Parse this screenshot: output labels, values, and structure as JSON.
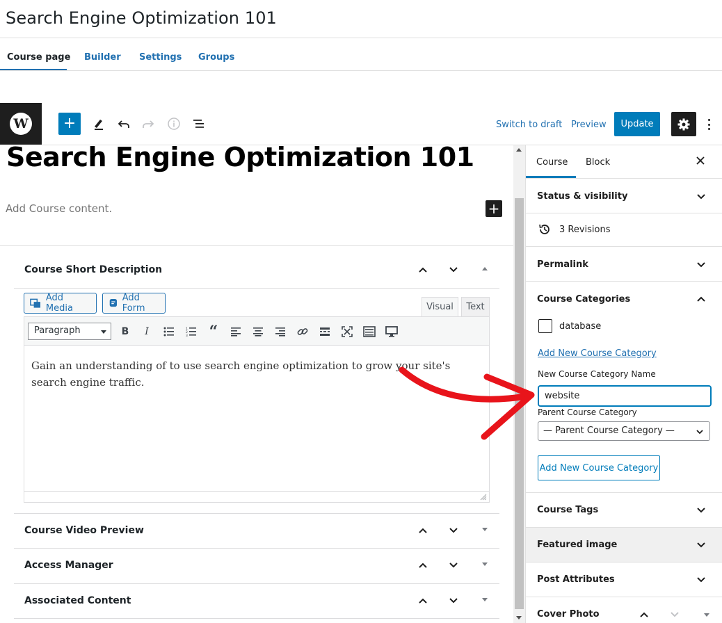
{
  "page": {
    "title": "Search Engine Optimization 101"
  },
  "tabs": [
    {
      "label": "Course page",
      "active": true
    },
    {
      "label": "Builder",
      "active": false
    },
    {
      "label": "Settings",
      "active": false
    },
    {
      "label": "Groups",
      "active": false
    }
  ],
  "toolbar": {
    "add_icon": "plus-icon",
    "switch_to_draft": "Switch to draft",
    "preview": "Preview",
    "update": "Update"
  },
  "editor": {
    "post_title": "Search Engine Optimization 101",
    "placeholder": "Add Course content."
  },
  "metaboxes": {
    "short_description": {
      "title": "Course Short Description",
      "add_media": "Add Media",
      "add_form": "Add Form",
      "visual_tab": "Visual",
      "text_tab": "Text",
      "format": "Paragraph",
      "content": "Gain an understanding of to use search engine optimization to grow your site's search engine traffic."
    },
    "video_preview": {
      "title": "Course Video Preview"
    },
    "access_manager": {
      "title": "Access Manager"
    },
    "associated_content": {
      "title": "Associated Content"
    }
  },
  "sidebar": {
    "tabs": [
      {
        "label": "Course",
        "active": true
      },
      {
        "label": "Block",
        "active": false
      }
    ],
    "panels": {
      "status": "Status & visibility",
      "revisions": "3 Revisions",
      "permalink": "Permalink",
      "categories": "Course Categories",
      "tags": "Course Tags",
      "featured_image": "Featured image",
      "post_attributes": "Post Attributes",
      "cover_photo": "Cover Photo"
    },
    "categories": {
      "items": [
        {
          "label": "database",
          "checked": false
        }
      ],
      "add_new_link": "Add New Course Category",
      "new_name_label": "New Course Category Name",
      "new_name_value": "website",
      "parent_label": "Parent Course Category",
      "parent_selected": "— Parent Course Category —",
      "add_button": "Add New Course Category"
    }
  },
  "colors": {
    "accent": "#007cba",
    "link": "#2271b1",
    "annotation_arrow": "#e8141b"
  }
}
